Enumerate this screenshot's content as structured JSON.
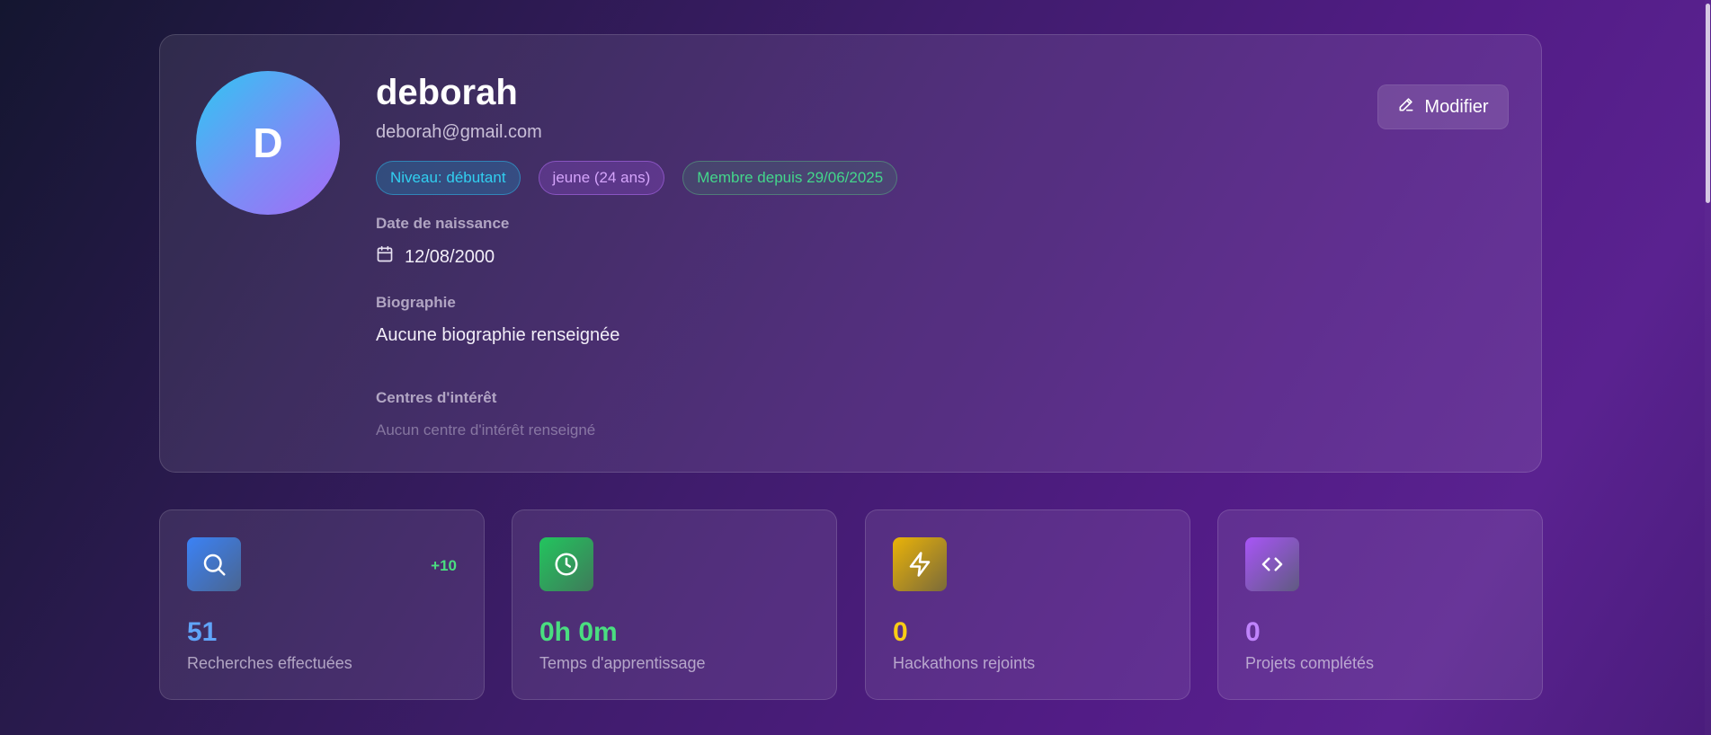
{
  "profile": {
    "avatar_initial": "D",
    "name": "deborah",
    "email": "deborah@gmail.com",
    "badges": {
      "level": "Niveau: débutant",
      "age": "jeune (24 ans)",
      "member_since": "Membre depuis 29/06/2025"
    },
    "birth_date_label": "Date de naissance",
    "birth_date": "12/08/2000",
    "bio_label": "Biographie",
    "bio": "Aucune biographie renseignée",
    "interests_label": "Centres d'intérêt",
    "interests_empty": "Aucun centre d'intérêt renseigné",
    "edit_label": "Modifier"
  },
  "stats": [
    {
      "value": "51",
      "label": "Recherches effectuées",
      "delta": "+10",
      "icon": "search-icon",
      "color": "#60a5fa"
    },
    {
      "value": "0h 0m",
      "label": "Temps d'apprentissage",
      "icon": "clock-icon",
      "color": "#4ade80"
    },
    {
      "value": "0",
      "label": "Hackathons rejoints",
      "icon": "lightning-icon",
      "color": "#facc15"
    },
    {
      "value": "0",
      "label": "Projets complétés",
      "icon": "code-icon",
      "color": "#c084fc"
    }
  ]
}
